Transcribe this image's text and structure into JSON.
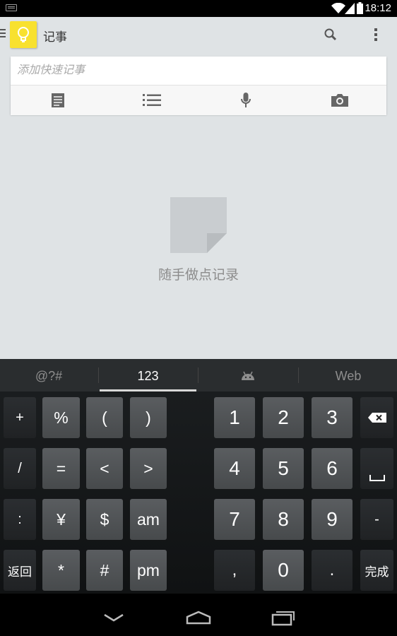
{
  "status_bar": {
    "time": "18:12"
  },
  "app": {
    "title": "记事",
    "quick_note": {
      "placeholder": "添加快速记事"
    },
    "empty_state": {
      "message": "随手做点记录"
    }
  },
  "keyboard": {
    "tabs": [
      "@?#",
      "123",
      "",
      "Web"
    ],
    "active_tab": "123",
    "rows": [
      [
        "+",
        "%",
        "(",
        ")",
        "1",
        "2",
        "3",
        "⌫"
      ],
      [
        "/",
        "=",
        "<",
        ">",
        "4",
        "5",
        "6",
        "␣"
      ],
      [
        ":",
        "¥",
        "$",
        "am",
        "7",
        "8",
        "9",
        "-"
      ],
      [
        "返回",
        "*",
        "#",
        "pm",
        ",",
        "0",
        ".",
        "完成"
      ]
    ]
  },
  "icons": {
    "status": [
      "keyboard-icon",
      "wifi-icon",
      "signal-icon",
      "battery-icon"
    ],
    "actionbar": [
      "drawer-icon",
      "lightbulb-icon",
      "search-icon",
      "overflow-menu-icon"
    ],
    "quick_note_actions": [
      "text-note-icon",
      "checklist-icon",
      "microphone-icon",
      "camera-icon"
    ],
    "nav": [
      "back-icon",
      "home-icon",
      "recents-icon"
    ]
  },
  "colors": {
    "app_background": "#dfe3e5",
    "logo_yellow": "#f8e12f",
    "keyboard_background": "#17191b"
  }
}
